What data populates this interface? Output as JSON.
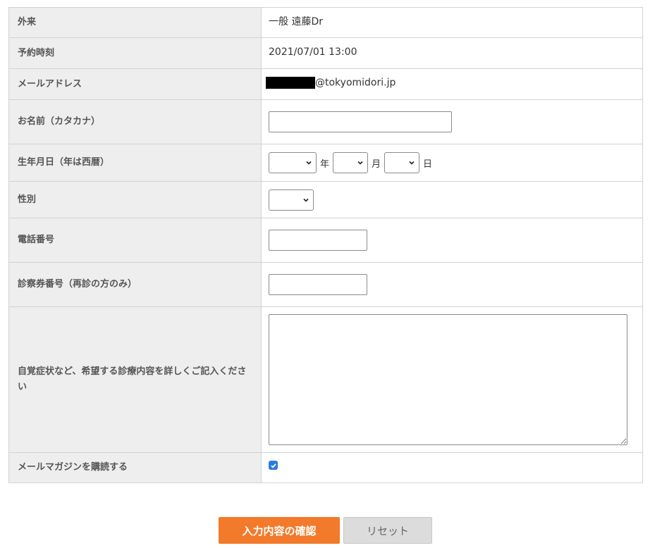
{
  "form": {
    "rows": {
      "department": {
        "label": "外来",
        "value": "一般 遠藤Dr"
      },
      "reservation_time": {
        "label": "予約時刻",
        "value": "2021/07/01 13:00"
      },
      "email": {
        "label": "メールアドレス",
        "value_domain": "@tokyomidori.jp"
      },
      "name_kana": {
        "label": "お名前（カタカナ）",
        "value": ""
      },
      "birthdate": {
        "label": "生年月日（年は西暦）",
        "year_unit": "年",
        "month_unit": "月",
        "day_unit": "日",
        "year": "",
        "month": "",
        "day": ""
      },
      "gender": {
        "label": "性別",
        "value": ""
      },
      "phone": {
        "label": "電話番号",
        "value": ""
      },
      "card_number": {
        "label": "診察券番号（再診の方のみ）",
        "value": ""
      },
      "symptoms": {
        "label": "自覚症状など、希望する診療内容を詳しくご記入ください",
        "value": ""
      },
      "newsletter": {
        "label": "メールマガジンを購読する",
        "checked": true
      }
    }
  },
  "buttons": {
    "confirm_label": "入力内容の確認",
    "reset_label": "リセット"
  },
  "colors": {
    "confirm_bg": "#f27a2a",
    "reset_bg": "#dcdcdc",
    "label_bg": "#eeeeee",
    "checkbox": "#2b7ae3"
  }
}
